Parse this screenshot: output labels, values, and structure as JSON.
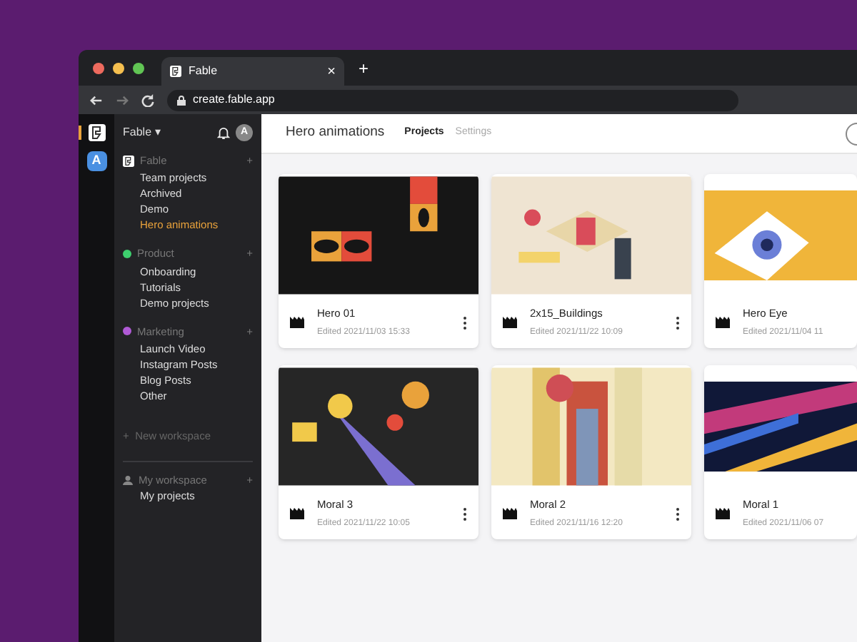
{
  "browser": {
    "tab_title": "Fable",
    "tab_close": "×",
    "new_tab": "+",
    "url": "create.fable.app"
  },
  "rail": [
    {
      "kind": "logo",
      "selected": true
    },
    {
      "kind": "letter",
      "label": "A",
      "selected": false
    }
  ],
  "sidebar": {
    "workspace": "Fable",
    "workspace_caret": "▾",
    "avatar": "A",
    "groups": [
      {
        "name": "Fable",
        "kind": "logo",
        "add": "+",
        "items": [
          {
            "label": "Team projects",
            "selected": false
          },
          {
            "label": "Archived",
            "selected": false
          },
          {
            "label": "Demo",
            "selected": false
          },
          {
            "label": "Hero animations",
            "selected": true
          }
        ]
      },
      {
        "name": "Product",
        "kind": "dot",
        "color": "#3ecf6e",
        "add": "+",
        "items": [
          {
            "label": "Onboarding",
            "selected": false
          },
          {
            "label": "Tutorials",
            "selected": false
          },
          {
            "label": "Demo projects",
            "selected": false
          }
        ]
      },
      {
        "name": "Marketing",
        "kind": "dot",
        "color": "#b05ad6",
        "add": "+",
        "items": [
          {
            "label": "Launch Video",
            "selected": false
          },
          {
            "label": "Instagram Posts",
            "selected": false
          },
          {
            "label": "Blog Posts",
            "selected": false
          },
          {
            "label": "Other",
            "selected": false
          }
        ]
      }
    ],
    "new_workspace": "New workspace",
    "new_workspace_plus": "+",
    "my_workspace": {
      "name": "My workspace",
      "add": "+",
      "items": [
        {
          "label": "My projects",
          "selected": false
        }
      ]
    }
  },
  "header": {
    "title": "Hero animations",
    "tabs": [
      {
        "label": "Projects",
        "selected": true
      },
      {
        "label": "Settings",
        "selected": false
      }
    ]
  },
  "projects": [
    {
      "name": "Hero 01",
      "edited": "Edited 2021/11/03 15:33",
      "kind": "eyes"
    },
    {
      "name": "2x15_Buildings",
      "edited": "Edited 2021/11/22 10:09",
      "kind": "buildings"
    },
    {
      "name": "Hero Eye",
      "edited": "Edited 2021/11/04 11",
      "kind": "eye"
    },
    {
      "name": "Moral 3",
      "edited": "Edited 2021/11/22 10:05",
      "kind": "planets"
    },
    {
      "name": "Moral 2",
      "edited": "Edited 2021/11/16 12:20",
      "kind": "arch"
    },
    {
      "name": "Moral 1",
      "edited": "Edited 2021/11/06 07",
      "kind": "ribbons"
    }
  ]
}
